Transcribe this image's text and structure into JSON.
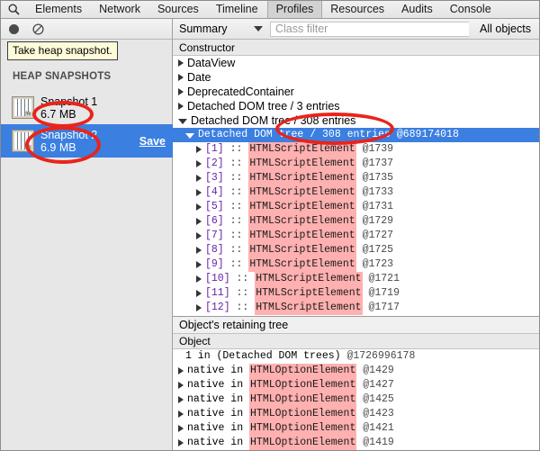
{
  "tabbar": {
    "search_icon": "search-icon",
    "tabs": [
      {
        "label": "Elements",
        "selected": false
      },
      {
        "label": "Network",
        "selected": false
      },
      {
        "label": "Sources",
        "selected": false
      },
      {
        "label": "Timeline",
        "selected": false
      },
      {
        "label": "Profiles",
        "selected": true
      },
      {
        "label": "Resources",
        "selected": false
      },
      {
        "label": "Audits",
        "selected": false
      },
      {
        "label": "Console",
        "selected": false
      }
    ]
  },
  "sidebar": {
    "record_button": "record-icon",
    "clear_button": "clear-icon",
    "tooltip": "Take heap snapshot.",
    "section_title": "HEAP SNAPSHOTS",
    "snapshots": [
      {
        "title": "Snapshot 1",
        "size": "6.7 MB",
        "selected": false,
        "save_label": ""
      },
      {
        "title": "Snapshot 2",
        "size": "6.9 MB",
        "selected": true,
        "save_label": "Save"
      }
    ]
  },
  "filter_bar": {
    "view_mode": "Summary",
    "class_filter_placeholder": "Class filter",
    "class_filter_value": "",
    "object_scope": "All objects"
  },
  "constructor_panel": {
    "column_header": "Constructor",
    "rows": [
      {
        "kind": "plain",
        "indent": 0,
        "disclosure": "closed",
        "label": "DataView"
      },
      {
        "kind": "plain",
        "indent": 0,
        "disclosure": "closed",
        "label": "Date"
      },
      {
        "kind": "plain",
        "indent": 0,
        "disclosure": "closed",
        "label": "DeprecatedContainer"
      },
      {
        "kind": "plain",
        "indent": 0,
        "disclosure": "closed",
        "label": "Detached DOM tree / 3 entries"
      },
      {
        "kind": "plain",
        "indent": 0,
        "disclosure": "open",
        "label": "Detached DOM tree / 308 entries"
      },
      {
        "kind": "mono-plain",
        "indent": 1,
        "disclosure": "open",
        "selected": true,
        "label": "Detached DOM tree / 308 entries",
        "objid": "@689174018"
      },
      {
        "kind": "entry",
        "indent": 2,
        "disclosure": "closed",
        "index": "[1]",
        "sep": "::",
        "cls": "HTMLScriptElement",
        "objid": "@1739"
      },
      {
        "kind": "entry",
        "indent": 2,
        "disclosure": "closed",
        "index": "[2]",
        "sep": "::",
        "cls": "HTMLScriptElement",
        "objid": "@1737"
      },
      {
        "kind": "entry",
        "indent": 2,
        "disclosure": "closed",
        "index": "[3]",
        "sep": "::",
        "cls": "HTMLScriptElement",
        "objid": "@1735"
      },
      {
        "kind": "entry",
        "indent": 2,
        "disclosure": "closed",
        "index": "[4]",
        "sep": "::",
        "cls": "HTMLScriptElement",
        "objid": "@1733"
      },
      {
        "kind": "entry",
        "indent": 2,
        "disclosure": "closed",
        "index": "[5]",
        "sep": "::",
        "cls": "HTMLScriptElement",
        "objid": "@1731"
      },
      {
        "kind": "entry",
        "indent": 2,
        "disclosure": "closed",
        "index": "[6]",
        "sep": "::",
        "cls": "HTMLScriptElement",
        "objid": "@1729"
      },
      {
        "kind": "entry",
        "indent": 2,
        "disclosure": "closed",
        "index": "[7]",
        "sep": "::",
        "cls": "HTMLScriptElement",
        "objid": "@1727"
      },
      {
        "kind": "entry",
        "indent": 2,
        "disclosure": "closed",
        "index": "[8]",
        "sep": "::",
        "cls": "HTMLScriptElement",
        "objid": "@1725"
      },
      {
        "kind": "entry",
        "indent": 2,
        "disclosure": "closed",
        "index": "[9]",
        "sep": "::",
        "cls": "HTMLScriptElement",
        "objid": "@1723"
      },
      {
        "kind": "entry",
        "indent": 2,
        "disclosure": "closed",
        "index": "[10]",
        "sep": "::",
        "cls": "HTMLScriptElement",
        "objid": "@1721"
      },
      {
        "kind": "entry",
        "indent": 2,
        "disclosure": "closed",
        "index": "[11]",
        "sep": "::",
        "cls": "HTMLScriptElement",
        "objid": "@1719"
      },
      {
        "kind": "entry",
        "indent": 2,
        "disclosure": "closed",
        "index": "[12]",
        "sep": "::",
        "cls": "HTMLScriptElement",
        "objid": "@1717"
      }
    ]
  },
  "retaining_panel": {
    "title": "Object's retaining tree",
    "column_header": "Object",
    "rows": [
      {
        "kind": "root",
        "disclosure": "none",
        "prefix": "1 in (Detached DOM trees)",
        "objid": "@1726996178"
      },
      {
        "kind": "native",
        "disclosure": "closed",
        "prefix": "native in",
        "cls": "HTMLOptionElement",
        "objid": "@1429"
      },
      {
        "kind": "native",
        "disclosure": "closed",
        "prefix": "native in",
        "cls": "HTMLOptionElement",
        "objid": "@1427"
      },
      {
        "kind": "native",
        "disclosure": "closed",
        "prefix": "native in",
        "cls": "HTMLOptionElement",
        "objid": "@1425"
      },
      {
        "kind": "native",
        "disclosure": "closed",
        "prefix": "native in",
        "cls": "HTMLOptionElement",
        "objid": "@1423"
      },
      {
        "kind": "native",
        "disclosure": "closed",
        "prefix": "native in",
        "cls": "HTMLOptionElement",
        "objid": "@1421"
      },
      {
        "kind": "native",
        "disclosure": "closed",
        "prefix": "native in",
        "cls": "HTMLOptionElement",
        "objid": "@1419"
      }
    ]
  },
  "annotations": {
    "color": "#e8241c",
    "circles": [
      {
        "target": "snapshot-1-size"
      },
      {
        "target": "snapshot-2-row"
      },
      {
        "target": "detached-dom-tree-308-entries"
      }
    ]
  }
}
